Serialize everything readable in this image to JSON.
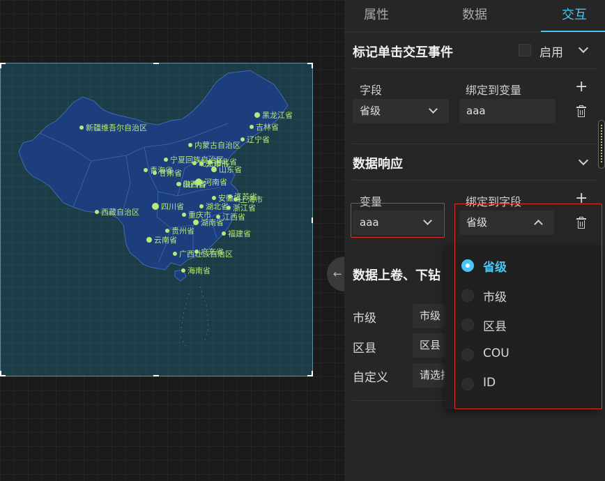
{
  "tabs": {
    "props": "属性",
    "data": "数据",
    "interaction": "交互"
  },
  "marker_click": {
    "title": "标记单击交互事件",
    "enable_label": "启用",
    "enabled": false,
    "field_header": "字段",
    "var_header": "绑定到变量",
    "field_value": "省级",
    "var_value": "aaa"
  },
  "data_response": {
    "title": "数据响应",
    "var_header": "变量",
    "field_header": "绑定到字段",
    "var_value": "aaa",
    "field_value": "省级"
  },
  "drill": {
    "title": "数据上卷、下钻",
    "rows": [
      {
        "label": "市级",
        "value": "市级"
      },
      {
        "label": "区县",
        "value": "区县"
      },
      {
        "label": "自定义",
        "value": "请选择"
      }
    ]
  },
  "dropdown": {
    "options": [
      "省级",
      "市级",
      "区县",
      "COU",
      "ID"
    ],
    "selected": "省级"
  },
  "map": {
    "labels": [
      "黑龙江省",
      "吉林省",
      "辽宁省",
      "新疆维吾尔自治区",
      "内蒙古自治区",
      "宁夏回族自治区",
      "北京市",
      "天津市",
      "河北省",
      "青海省",
      "甘肃省",
      "山西省",
      "山东省",
      "陕西省",
      "河南省",
      "江苏省",
      "安徽省",
      "上海市",
      "浙江省",
      "西藏自治区",
      "四川省",
      "重庆市",
      "湖北省",
      "湖南省",
      "江西省",
      "贵州省",
      "福建省",
      "云南省",
      "广西壮族自治区",
      "广东省",
      "海南省"
    ]
  },
  "colors": {
    "accent": "#49c6f5",
    "map_fill": "#1d3e7c",
    "map_bg": "#1c3c48",
    "label": "#b7e87a",
    "highlight": "#e2312c"
  }
}
